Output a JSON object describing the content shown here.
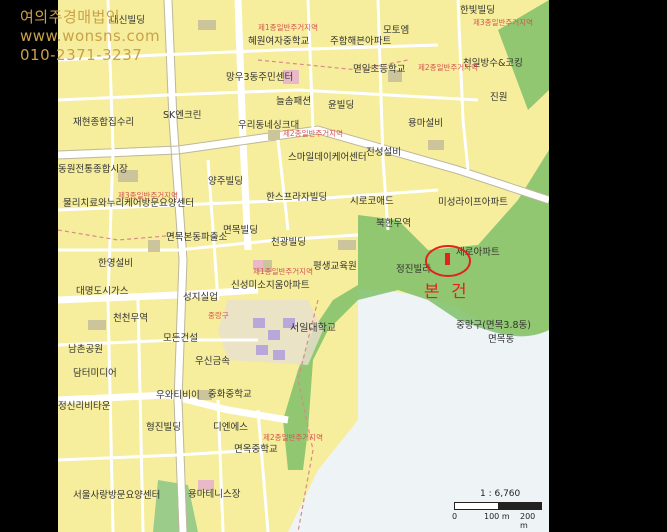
{
  "company": {
    "name": "여의주경매법인",
    "website": "www.wonsns.com",
    "phone": "010-2371-3237"
  },
  "property": {
    "label": "본 건",
    "marker_color": "#e2231a"
  },
  "scale": {
    "ratio": "1 : 6,760",
    "ticks": [
      "0",
      "100 m",
      "200 m"
    ]
  },
  "colors": {
    "land": "#f6ee9c",
    "park": "#7fbf6a",
    "water": "#eef4f6",
    "road": "#ffffff",
    "brand_text": "#c9a14a"
  },
  "places": [
    "대신빌딩",
    "혜원여자중학교",
    "주함해븐아파트",
    "모토엠",
    "한빛빌딩",
    "천일방수&코킹",
    "망우3동주민센터",
    "면일초등학교",
    "늘솜패션",
    "윤빌딩",
    "진원",
    "용마설비",
    "재현종합집수리",
    "SK엔크린",
    "우리동네싱크대",
    "스마일데이케어센터",
    "진성설비",
    "동원전통종합시장",
    "물리치료와누리케어방문요양센터",
    "양주빌딩",
    "한스프라자빌딩",
    "시로코애드",
    "미성라이프아파트",
    "북한무역",
    "면목본동파출소",
    "면목빌딩",
    "천광빌딩",
    "한영설비",
    "평생교육원",
    "정진빌라",
    "제로아파트",
    "대명도시가스",
    "신성미소지움아파트",
    "성지실업",
    "천천무역",
    "서일대학교",
    "중랑구(면목3.8동)",
    "면목동",
    "남촌공원",
    "모든건설",
    "우신금속",
    "담터미디어",
    "우와티비이",
    "중화중학교",
    "정신리비타운",
    "디엔에스",
    "형진빌딩",
    "면옥중학교",
    "서울사랑방문요양센터",
    "용마테니스장"
  ],
  "road_labels": [
    "제1종일반주거지역",
    "제2종일반주거지역",
    "제3종일반주거지역",
    "중랑구"
  ]
}
